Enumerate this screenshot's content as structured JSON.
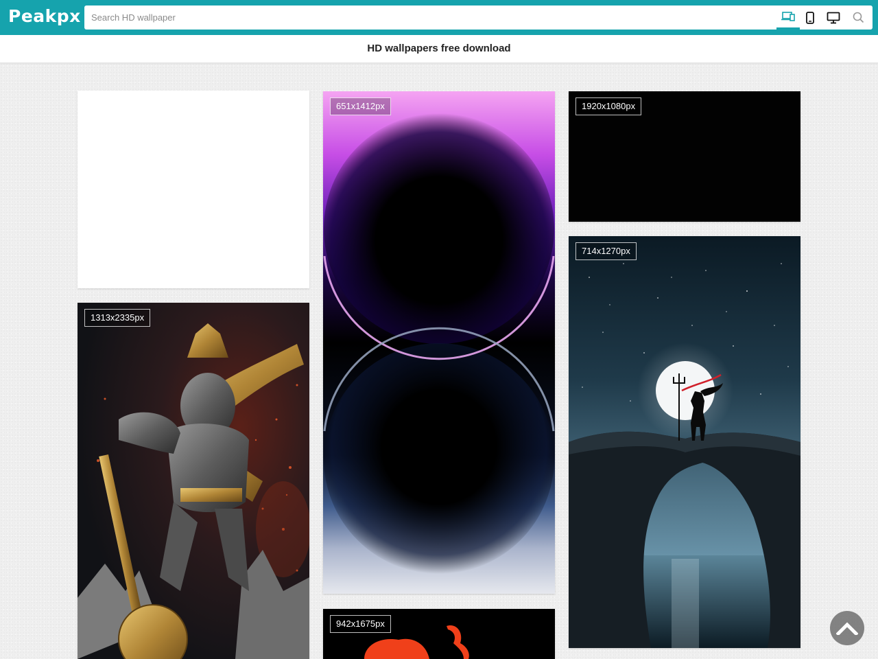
{
  "header": {
    "logo": "Peakpx",
    "search_placeholder": "Search HD wallpaper",
    "devices": [
      {
        "name": "all-devices",
        "icon": "devices-icon",
        "active": true
      },
      {
        "name": "mobile",
        "icon": "phone-icon",
        "active": false
      },
      {
        "name": "desktop",
        "icon": "monitor-icon",
        "active": false
      }
    ],
    "search_icon": "search-icon",
    "accent_color": "#16a3ad"
  },
  "subheader": {
    "title": "HD wallpapers free download"
  },
  "wallpapers": {
    "ad_slot": {
      "label": ""
    },
    "purple_sphere": {
      "resolution": "651x1412px"
    },
    "black_screen": {
      "resolution": "1920x1080px"
    },
    "shiva_moon": {
      "resolution": "714x1270px"
    },
    "hanuman": {
      "resolution": "1313x2335px"
    },
    "red_art": {
      "resolution": "942x1675px"
    }
  },
  "scroll_top_icon": "chevron-up-icon"
}
